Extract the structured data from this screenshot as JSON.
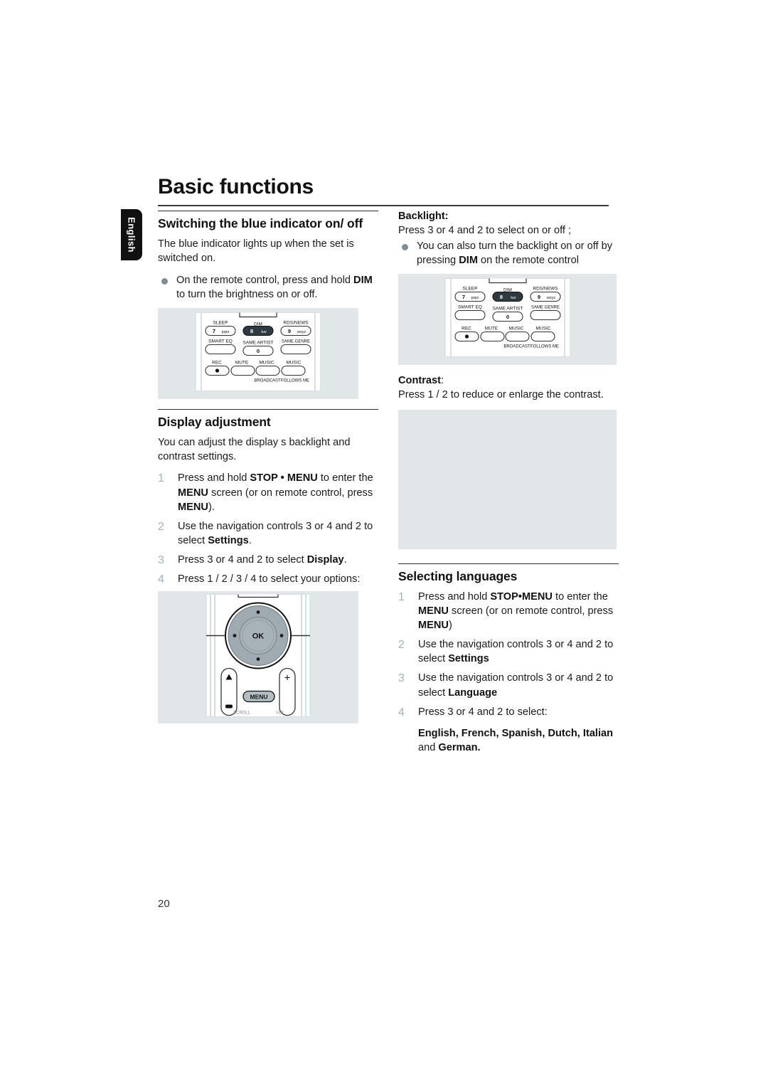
{
  "document": {
    "title": "Basic functions",
    "language_tab": "English",
    "page_number": "20"
  },
  "colors": {
    "bullet": "#7e8e96",
    "step_number": "#9fb3ba",
    "figure_background": "#e1e6e9",
    "rule": "#2e2e2e",
    "tab_background": "#111111"
  },
  "left_column": {
    "section1": {
      "heading": "Switching the blue indicator on/ off",
      "intro": "The blue indicator lights up when the set is switched on.",
      "bullets": [
        {
          "pre": "On the remote control, press and hold ",
          "bold": "DIM",
          "post": " to turn the brightness on or off."
        }
      ]
    },
    "section2": {
      "heading": "Display adjustment",
      "intro": "You can adjust the display s backlight and contrast settings.",
      "steps": [
        {
          "num": "1",
          "parts": [
            {
              "t": "Press and hold ",
              "b": false
            },
            {
              "t": "STOP • MENU",
              "b": true
            },
            {
              "t": " to enter the ",
              "b": false
            },
            {
              "t": "MENU",
              "b": true
            },
            {
              "t": " screen (or on remote control, press ",
              "b": false
            },
            {
              "t": "MENU",
              "b": true
            },
            {
              "t": ").",
              "b": false
            }
          ]
        },
        {
          "num": "2",
          "parts": [
            {
              "t": "Use the navigation controls ",
              "b": false
            },
            {
              "t": "3",
              "b": false
            },
            {
              "t": " or ",
              "b": false
            },
            {
              "t": "4",
              "b": false
            },
            {
              "t": " and ",
              "b": false
            },
            {
              "t": "2",
              "b": false
            },
            {
              "t": " to select ",
              "b": false
            },
            {
              "t": "Settings",
              "b": true
            },
            {
              "t": ".",
              "b": false
            }
          ]
        },
        {
          "num": "3",
          "parts": [
            {
              "t": "Press ",
              "b": false
            },
            {
              "t": "3",
              "b": false
            },
            {
              "t": " or ",
              "b": false
            },
            {
              "t": "4",
              "b": false
            },
            {
              "t": " and ",
              "b": false
            },
            {
              "t": "2",
              "b": false
            },
            {
              "t": " to select ",
              "b": false
            },
            {
              "t": "Display",
              "b": true
            },
            {
              "t": ".",
              "b": false
            }
          ]
        },
        {
          "num": "4",
          "parts": [
            {
              "t": "Press ",
              "b": false
            },
            {
              "t": "1",
              "b": false
            },
            {
              "t": " / ",
              "b": false
            },
            {
              "t": "2",
              "b": false
            },
            {
              "t": " / ",
              "b": false
            },
            {
              "t": "3",
              "b": false
            },
            {
              "t": " / ",
              "b": false
            },
            {
              "t": "4",
              "b": false
            },
            {
              "t": " to select your options:",
              "b": false
            }
          ]
        }
      ]
    }
  },
  "right_column": {
    "backlight": {
      "heading": "Backlight:",
      "line1": "Press 3 or 4 and 2 to select on or off ;",
      "bullet": {
        "pre": "You can also turn the backlight on or off by pressing ",
        "bold": "DIM",
        "post": " on the remote control"
      }
    },
    "contrast": {
      "heading": "Contrast",
      "heading_suffix": ":",
      "line1": "Press 1 / 2 to reduce or enlarge the contrast."
    },
    "section_languages": {
      "heading": "Selecting languages",
      "steps": [
        {
          "num": "1",
          "parts": [
            {
              "t": "Press and hold ",
              "b": false
            },
            {
              "t": "STOP•MENU",
              "b": true
            },
            {
              "t": " to enter the ",
              "b": false
            },
            {
              "t": "MENU",
              "b": true
            },
            {
              "t": " screen (or on remote control, press ",
              "b": false
            },
            {
              "t": "MENU",
              "b": true
            },
            {
              "t": ")",
              "b": false
            }
          ]
        },
        {
          "num": "2",
          "parts": [
            {
              "t": "Use the navigation controls ",
              "b": false
            },
            {
              "t": "3",
              "b": false
            },
            {
              "t": " or ",
              "b": false
            },
            {
              "t": "4",
              "b": false
            },
            {
              "t": " and ",
              "b": false
            },
            {
              "t": "2",
              "b": false
            },
            {
              "t": " to select ",
              "b": false
            },
            {
              "t": "Settings",
              "b": true
            }
          ]
        },
        {
          "num": "3",
          "parts": [
            {
              "t": "Use the navigation controls ",
              "b": false
            },
            {
              "t": "3",
              "b": false
            },
            {
              "t": " or ",
              "b": false
            },
            {
              "t": "4",
              "b": false
            },
            {
              "t": " and ",
              "b": false
            },
            {
              "t": "2",
              "b": false
            },
            {
              "t": " to select ",
              "b": false
            },
            {
              "t": "Language",
              "b": true
            }
          ]
        },
        {
          "num": "4",
          "parts": [
            {
              "t": "Press ",
              "b": false
            },
            {
              "t": "3",
              "b": false
            },
            {
              "t": " or ",
              "b": false
            },
            {
              "t": "4",
              "b": false
            },
            {
              "t": " and ",
              "b": false
            },
            {
              "t": "2",
              "b": false
            },
            {
              "t": " to select:",
              "b": false
            }
          ]
        }
      ],
      "languages_bold": "English, French, Spanish, Dutch, Italian",
      "languages_tail_plain": "and ",
      "languages_tail_bold": "German."
    }
  },
  "figures": {
    "remote_keypad": {
      "name": "remote-control-keypad",
      "buttons": [
        {
          "label": "SLEEP",
          "key": "7",
          "sub": "pqrs",
          "highlight": false
        },
        {
          "label": "DIM",
          "key": "8",
          "sub": "tuv",
          "highlight": true
        },
        {
          "label": "RDS/NEWS",
          "key": "9",
          "sub": "wxyz",
          "highlight": false
        },
        {
          "label": "SMART EQ",
          "key": "",
          "sub": "",
          "highlight": false
        },
        {
          "label": "SAME ARTIST",
          "key": "0",
          "sub": "",
          "highlight": false
        },
        {
          "label": "SAME GENRE",
          "key": "",
          "sub": "",
          "highlight": false
        },
        {
          "label": "REC",
          "key": "",
          "sub": "",
          "highlight": false
        },
        {
          "label": "MUTE",
          "key": "",
          "sub": "",
          "highlight": false
        },
        {
          "label": "MUSIC",
          "key": "",
          "sub": "",
          "highlight": false
        },
        {
          "label": "MUSIC",
          "key": "",
          "sub": "",
          "highlight": false
        }
      ],
      "bottom_labels": [
        "BROADCAST",
        "FOLLOWS ME"
      ]
    },
    "nav_pad": {
      "name": "remote-navigation-pad",
      "center_label": "OK",
      "menu_label": "MENU",
      "left_rocker": {
        "top": "▲",
        "bottom": "▬"
      },
      "right_rocker": {
        "top": "+",
        "bottom": "▬"
      }
    },
    "blank_placeholder": {
      "name": "display-illustration-placeholder"
    }
  }
}
